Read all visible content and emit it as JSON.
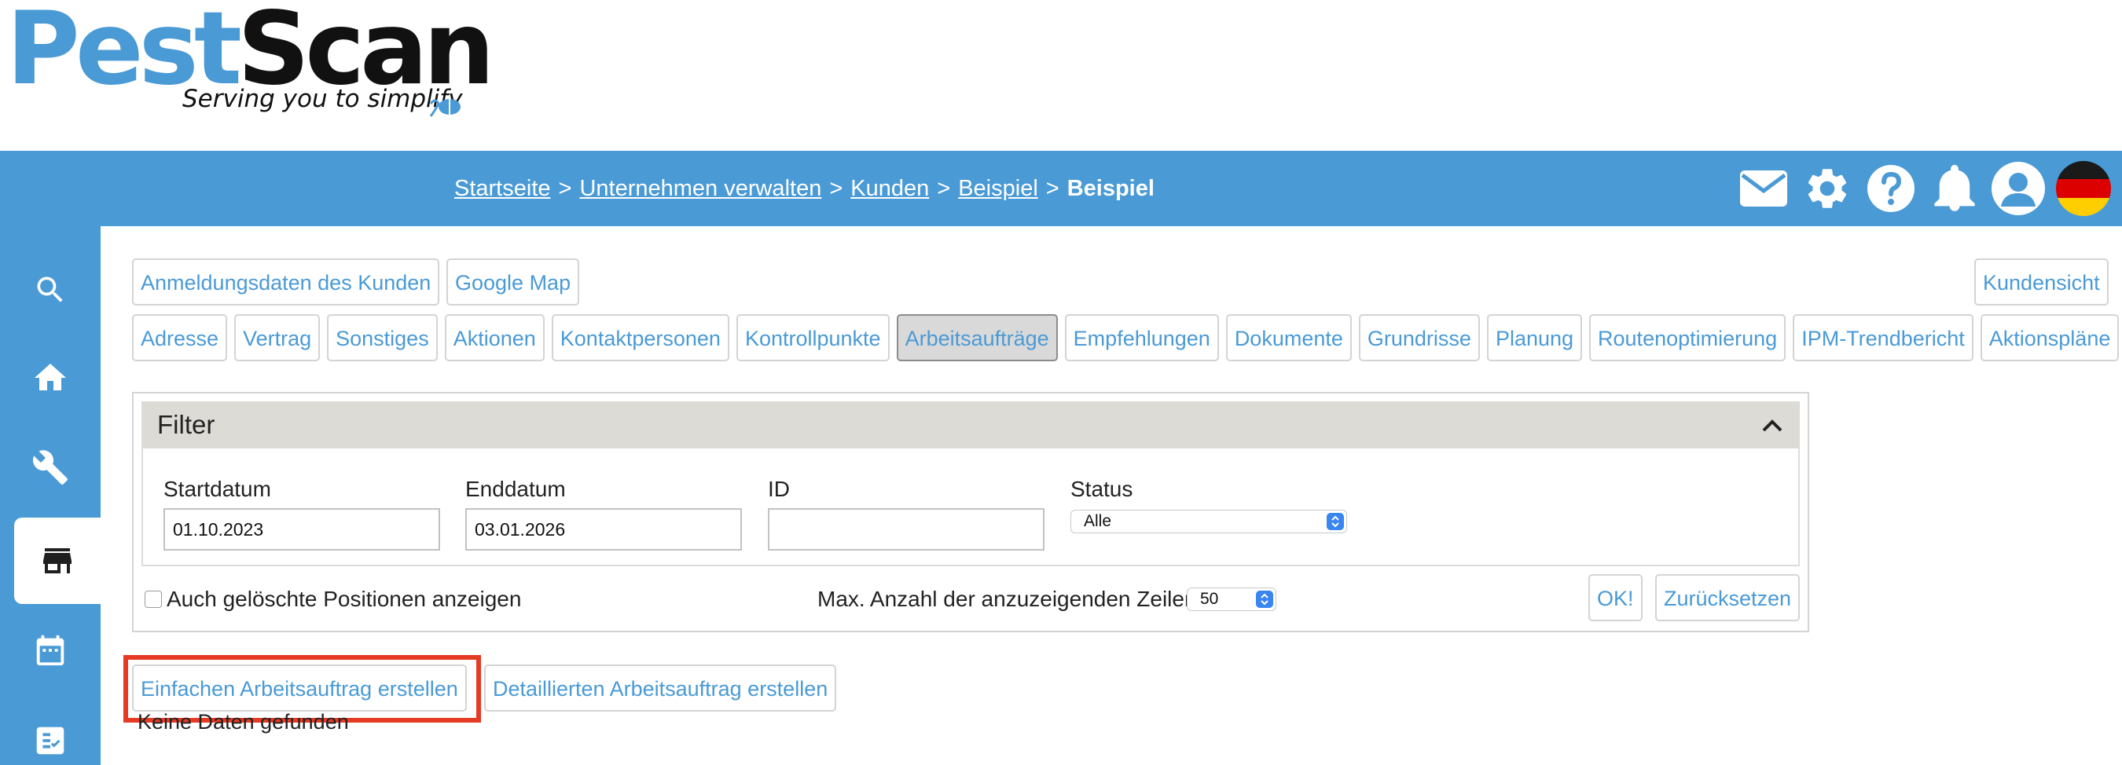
{
  "logo": {
    "word1": "Pest",
    "word2": "Scan",
    "tagline": "Serving you to simplify"
  },
  "breadcrumb": {
    "items": [
      "Startseite",
      "Unternehmen verwalten",
      "Kunden",
      "Beispiel"
    ],
    "separator": ">",
    "current": "Beispiel"
  },
  "header_icons": [
    "mail-icon",
    "gear-icon",
    "help-icon",
    "bell-icon",
    "user-icon",
    "german-flag-icon"
  ],
  "sidebar": {
    "items": [
      {
        "icon": "search-icon",
        "active": false
      },
      {
        "icon": "home-icon",
        "active": false
      },
      {
        "icon": "wrench-icon",
        "active": false
      },
      {
        "icon": "store-icon",
        "active": true
      },
      {
        "icon": "calendar-icon",
        "active": false
      },
      {
        "icon": "checklist-icon",
        "active": false
      }
    ]
  },
  "top_buttons": {
    "login": "Anmeldungsdaten des Kunden",
    "map": "Google Map",
    "customer_view": "Kundensicht"
  },
  "tabs": [
    "Adresse",
    "Vertrag",
    "Sonstiges",
    "Aktionen",
    "Kontaktpersonen",
    "Kontrollpunkte",
    "Arbeitsaufträge",
    "Empfehlungen",
    "Dokumente",
    "Grundrisse",
    "Planung",
    "Routenoptimierung",
    "IPM-Trendbericht",
    "Aktionspläne"
  ],
  "selected_tab": "Arbeitsaufträge",
  "filter": {
    "title": "Filter",
    "start_label": "Startdatum",
    "start_value": "01.10.2023",
    "end_label": "Enddatum",
    "end_value": "03.01.2026",
    "id_label": "ID",
    "id_value": "",
    "status_label": "Status",
    "status_value": "Alle",
    "show_deleted_label": "Auch gelöschte Positionen anzeigen",
    "show_deleted_checked": false,
    "max_rows_label": "Max. Anzahl der anzuzeigenden Zeilen",
    "max_rows_value": "50",
    "ok_label": "OK!",
    "reset_label": "Zurücksetzen"
  },
  "actions": {
    "simple": "Einfachen Arbeitsauftrag erstellen",
    "detailed": "Detaillierten Arbeitsauftrag erstellen"
  },
  "no_data": "Keine Daten gefunden",
  "colors": {
    "brand_blue": "#4a9ad6",
    "highlight_red": "#e53a24",
    "filter_header": "#dcdbd6"
  }
}
